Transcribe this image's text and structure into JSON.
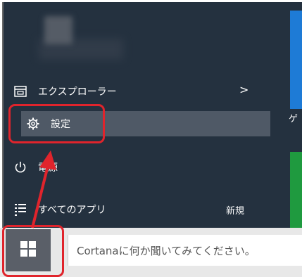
{
  "start_menu": {
    "items": [
      {
        "label": "エクスプローラー",
        "icon": "file-explorer-icon"
      },
      {
        "label": "設定",
        "icon": "gear-icon"
      },
      {
        "label": "電源",
        "icon": "power-icon"
      },
      {
        "label": "すべてのアプリ",
        "icon": "all-apps-icon"
      }
    ],
    "explorer_chevron": ">",
    "new_badge": "新規"
  },
  "tiles": {
    "partial_text": "ゲ"
  },
  "taskbar": {
    "search_placeholder": "Cortanaに何か聞いてみてください。",
    "start_icon": "windows-logo-icon"
  },
  "annotations": {
    "highlight_color": "#e0242c"
  }
}
